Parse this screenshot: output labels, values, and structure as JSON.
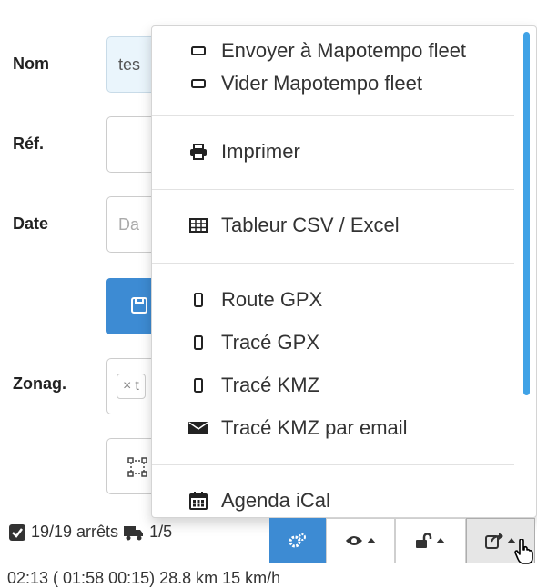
{
  "form": {
    "name_label": "Nom",
    "name_value": "tes",
    "ref_label": "Réf.",
    "date_label": "Date",
    "date_placeholder": "Da",
    "zone_label": "Zonag.",
    "zone_tag_remove": "×",
    "zone_tag_text": "t"
  },
  "menu": {
    "items": [
      {
        "icon": "tablet-landscape-icon",
        "label": "Envoyer à Mapotempo fleet"
      },
      {
        "icon": "tablet-landscape-icon",
        "label": "Vider Mapotempo fleet"
      },
      {
        "icon": "print-icon",
        "label": "Imprimer"
      },
      {
        "icon": "table-icon",
        "label": "Tableur CSV / Excel"
      },
      {
        "icon": "mobile-icon",
        "label": "Route GPX"
      },
      {
        "icon": "mobile-icon",
        "label": "Tracé GPX"
      },
      {
        "icon": "mobile-icon",
        "label": "Tracé KMZ"
      },
      {
        "icon": "envelope-icon",
        "label": "Tracé KMZ par email"
      },
      {
        "icon": "calendar-icon",
        "label": "Agenda iCal"
      }
    ]
  },
  "stats": {
    "stops": "19/19 arrêts",
    "vehicle": "1/5",
    "bottom_line": "02:13 ( 01:58 00:15) 28.8 km 15 km/h"
  },
  "colors": {
    "primary": "#3d8bd3",
    "scrollbar": "#40a2e6",
    "field_highlight": "#eaf5fc"
  }
}
